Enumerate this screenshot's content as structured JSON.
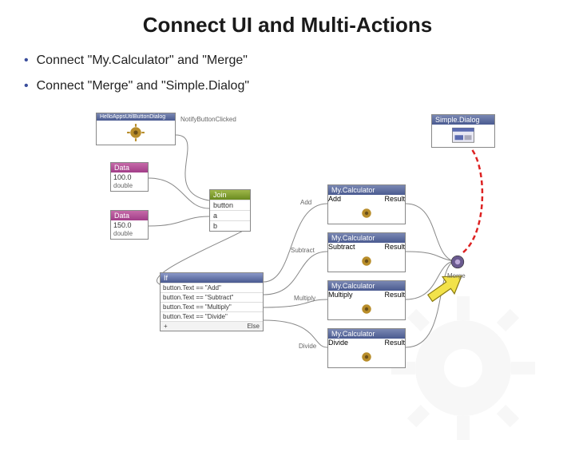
{
  "title": "Connect UI and Multi-Actions",
  "bullets": [
    "Connect \"My.Calculator\" and \"Merge\"",
    "Connect \"Merge\" and \"Simple.Dialog\""
  ],
  "nodes": {
    "helloApps": {
      "header": "HelloAppsUtilButtonDialog",
      "port": "NotifyButtonClicked"
    },
    "data1": {
      "header": "Data",
      "value": "100.0",
      "type": "double"
    },
    "data2": {
      "header": "Data",
      "value": "150.0",
      "type": "double"
    },
    "join": {
      "header": "Join",
      "rows": [
        "button",
        "a",
        "b"
      ]
    },
    "if": {
      "header": "If",
      "rows": [
        "button.Text == \"Add\"",
        "button.Text == \"Subtract\"",
        "button.Text == \"Multiply\"",
        "button.Text == \"Divide\""
      ],
      "plus": "+",
      "else": "Else"
    },
    "calc": {
      "header": "My.Calculator",
      "ops": [
        "Add",
        "Subtract",
        "Multiply",
        "Divide"
      ],
      "result": "Result"
    },
    "merge": {
      "header": "Merge"
    },
    "simpleDialog": {
      "header": "Simple.Dialog"
    }
  }
}
